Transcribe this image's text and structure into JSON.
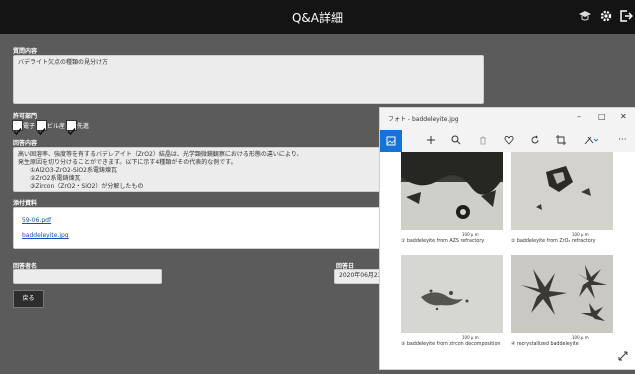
{
  "header": {
    "title": "Q&A詳細",
    "icons": [
      "graduation-cap-icon",
      "gear-icon",
      "logout-icon"
    ]
  },
  "form": {
    "question_label": "質問内容",
    "question_value": "バデライト欠点の種類の見分け方",
    "section_label": "許可部門",
    "checkboxes": [
      {
        "label": "電子",
        "checked": true
      },
      {
        "label": "ビル産",
        "checked": true
      },
      {
        "label": "先進",
        "checked": true
      }
    ],
    "answer_label": "回答内容",
    "answer_lines": [
      "高い固溶率、強度等を有するバデレアイト（ZrO2）結晶は、光学顕微鏡観察における形態の違いにより、",
      "発生原因を切り分けることができます。以下に示す4種類がその代表的な例です。",
      "①Al2O3-ZrO2-SiO2系電鋳煉瓦",
      "②ZrO2系電鋳煉瓦",
      "③Zircon（ZrO2・SiO2）が分解したもの"
    ],
    "attachment_label": "添付資料",
    "attachments": [
      "59-06.pdf",
      "baddeleyite.jpg"
    ],
    "responder_label": "回答者名",
    "date_label": "回答日",
    "date_value": "2020年06月23",
    "back_button": "戻る"
  },
  "photo_viewer": {
    "title": "フォト - baddeleyite.jpg",
    "window_controls": [
      "–",
      "□",
      "✕"
    ],
    "toolbar": [
      "image-icon",
      "plus-icon",
      "zoom-icon",
      "trash-icon",
      "heart-icon",
      "rotate-icon",
      "crop-icon",
      "edit-icon",
      "more-icon"
    ],
    "scale_label": "100 μ m",
    "captions": [
      "① baddeleyite from AZS refractory",
      "② baddeleyite from ZrO₂ refractory",
      "③ baddeleyite from zircon decomposition",
      "④ recrystallized baddeleyite"
    ]
  }
}
